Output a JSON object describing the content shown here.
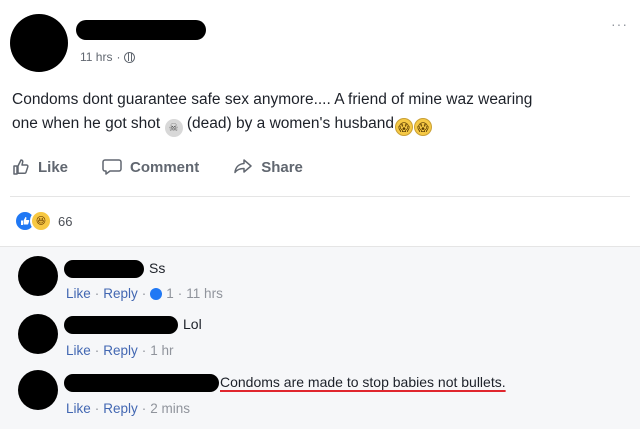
{
  "post": {
    "time": "11 hrs",
    "separator": "·",
    "more": "···",
    "text_line1": "Condoms dont guarantee safe sex anymore.... A friend of mine waz wearing",
    "text_line2_a": "one when he got shot",
    "text_line2_b": "(dead) by a women's husband",
    "emoji_skull": "skull-emoji",
    "emoji_scream": "scream-emoji"
  },
  "actions": {
    "like": "Like",
    "comment": "Comment",
    "share": "Share"
  },
  "reactions": {
    "count": "66"
  },
  "comments": [
    {
      "text": "Ss",
      "like": "Like",
      "reply": "Reply",
      "likes": "1",
      "time": "11 hrs"
    },
    {
      "text": "Lol",
      "like": "Like",
      "reply": "Reply",
      "time": "1 hr"
    },
    {
      "text": "Condoms are made to stop babies not bullets.",
      "like": "Like",
      "reply": "Reply",
      "time": "2 mins"
    }
  ],
  "colors": {
    "link": "#4267b2",
    "meta": "#90949c",
    "underline": "#e0262e"
  }
}
